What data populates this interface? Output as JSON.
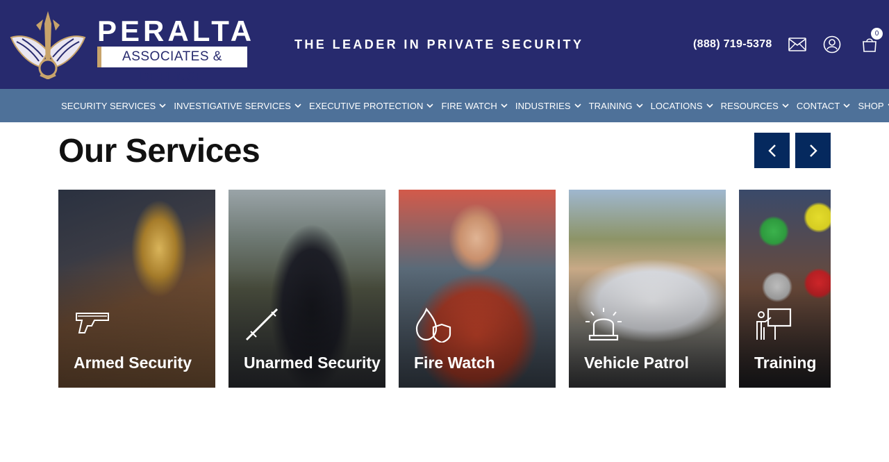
{
  "header": {
    "brand_name": "PERALTA",
    "brand_sub": "ASSOCIATES & DEFENSE",
    "tagline": "THE LEADER IN PRIVATE SECURITY",
    "phone": "(888) 719-5378",
    "cart_count": "0",
    "icons": [
      "mail-icon",
      "user-icon",
      "cart-icon"
    ]
  },
  "nav": {
    "items": [
      {
        "label": "SECURITY SERVICES"
      },
      {
        "label": "INVESTIGATIVE SERVICES"
      },
      {
        "label": "EXECUTIVE PROTECTION"
      },
      {
        "label": "FIRE WATCH"
      },
      {
        "label": "INDUSTRIES"
      },
      {
        "label": "TRAINING"
      },
      {
        "label": "LOCATIONS"
      },
      {
        "label": "RESOURCES"
      },
      {
        "label": "CONTACT"
      },
      {
        "label": "SHOP"
      }
    ]
  },
  "main": {
    "title": "Our Services",
    "cards": [
      {
        "title": "Armed Security",
        "icon": "pistol-icon"
      },
      {
        "title": "Unarmed Security",
        "icon": "baton-icon"
      },
      {
        "title": "Fire Watch",
        "icon": "flame-shield-icon"
      },
      {
        "title": "Vehicle Patrol",
        "icon": "siren-icon"
      },
      {
        "title": "Training",
        "icon": "presentation-icon"
      }
    ]
  },
  "colors": {
    "header_bg": "#272a6e",
    "nav_bg": "#4e7199",
    "arrow_bg": "#05295e",
    "brand_gold": "#c8a46b"
  }
}
